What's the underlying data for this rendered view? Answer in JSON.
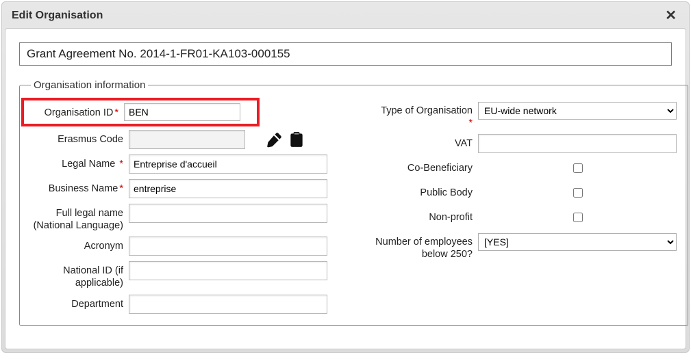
{
  "dialog": {
    "title": "Edit Organisation"
  },
  "agreement": {
    "label_prefix": "Grant Agreement No. ",
    "number": "2014-1-FR01-KA103-000155"
  },
  "fieldset": {
    "legend": "Organisation information"
  },
  "labels": {
    "org_id": "Organisation ID",
    "erasmus_code": "Erasmus Code",
    "legal_name": "Legal Name",
    "business_name": "Business Name",
    "full_legal_name": "Full legal name (National Language)",
    "acronym": "Acronym",
    "national_id": "National ID (if applicable)",
    "department": "Department",
    "type_of_org": "Type of Organisation",
    "vat": "VAT",
    "co_beneficiary": "Co-Beneficiary",
    "public_body": "Public Body",
    "non_profit": "Non-profit",
    "num_employees": "Number of employees below 250?"
  },
  "values": {
    "org_id": "BEN",
    "erasmus_code": "",
    "legal_name": "Entreprise d'accueil",
    "business_name": "entreprise",
    "full_legal_name": "",
    "acronym": "",
    "national_id": "",
    "department": "",
    "type_of_org_selected": "EU-wide network",
    "vat": "",
    "co_beneficiary": false,
    "public_body": false,
    "non_profit": false,
    "num_employees_selected": "[YES]"
  },
  "options": {
    "type_of_org": [
      "EU-wide network"
    ],
    "num_employees": [
      "[YES]"
    ]
  },
  "icons": {
    "edit": "edit-icon",
    "clipboard": "clipboard-icon",
    "close": "close-icon"
  }
}
